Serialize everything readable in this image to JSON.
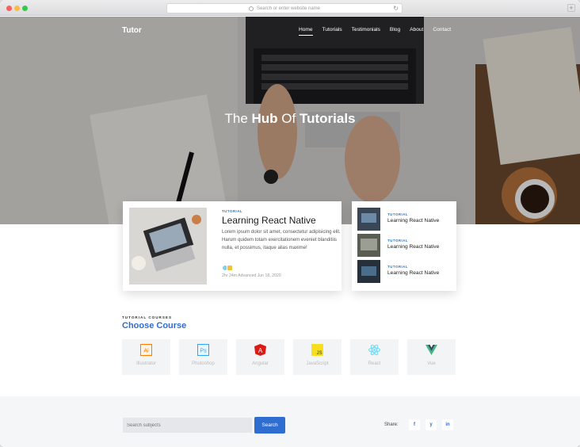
{
  "browser": {
    "url_placeholder": "Search or enter website name",
    "reload_glyph": "↻",
    "new_tab_glyph": "+"
  },
  "site": {
    "brand": "Tutor",
    "nav": [
      "Home",
      "Tutorials",
      "Testimonials",
      "Blog",
      "About",
      "Contact"
    ],
    "active_nav": "Home",
    "hero_pre": "The ",
    "hero_bold1": "Hub",
    "hero_mid": " Of ",
    "hero_bold2": "Tutorials"
  },
  "featured": {
    "tag": "TUTORIAL",
    "title": "Learning React Native",
    "text": "Lorem ipsum dolor sit amet, consectetur adipisicing elit. Harum quidem totam exercitationem eveniet blanditiis nulla, et possimus, itaque alias maxime!",
    "meta": "2hr 24m   Advanced   Jun 18, 2020"
  },
  "side_items": [
    {
      "tag": "TUTORIAL",
      "title": "Learning React Native"
    },
    {
      "tag": "TUTORIAL",
      "title": "Learning React Native"
    },
    {
      "tag": "TUTORIAL",
      "title": "Learning React Native"
    }
  ],
  "courses_section": {
    "tag": "TUTORIAL COURSES",
    "title": "Choose Course",
    "courses": [
      {
        "name": "Illustrator",
        "icon": "illustrator-icon",
        "color": "#ff7c00",
        "glyph": "Ai"
      },
      {
        "name": "Photoshop",
        "icon": "photoshop-icon",
        "color": "#2fa3f7",
        "glyph": "Ps"
      },
      {
        "name": "Angular",
        "icon": "angular-icon",
        "color": "#dd1b16",
        "glyph": "A"
      },
      {
        "name": "JavaScript",
        "icon": "javascript-icon",
        "color": "#f7df1e",
        "glyph": "JS"
      },
      {
        "name": "React",
        "icon": "react-icon",
        "color": "#61dafb",
        "glyph": "⚛"
      },
      {
        "name": "Vue",
        "icon": "vue-icon",
        "color": "#41b883",
        "glyph": "V"
      }
    ]
  },
  "footer": {
    "search_placeholder": "Search subjects",
    "search_button": "Search",
    "share_label": "Share:",
    "social": [
      {
        "icon": "facebook-icon",
        "glyph": "f"
      },
      {
        "icon": "twitter-icon",
        "glyph": "y"
      },
      {
        "icon": "linkedin-icon",
        "glyph": "in"
      }
    ]
  },
  "colors": {
    "accent": "#2f6dd1",
    "course_bg": "#f3f4f6",
    "footer_bg": "#f4f6f8"
  }
}
